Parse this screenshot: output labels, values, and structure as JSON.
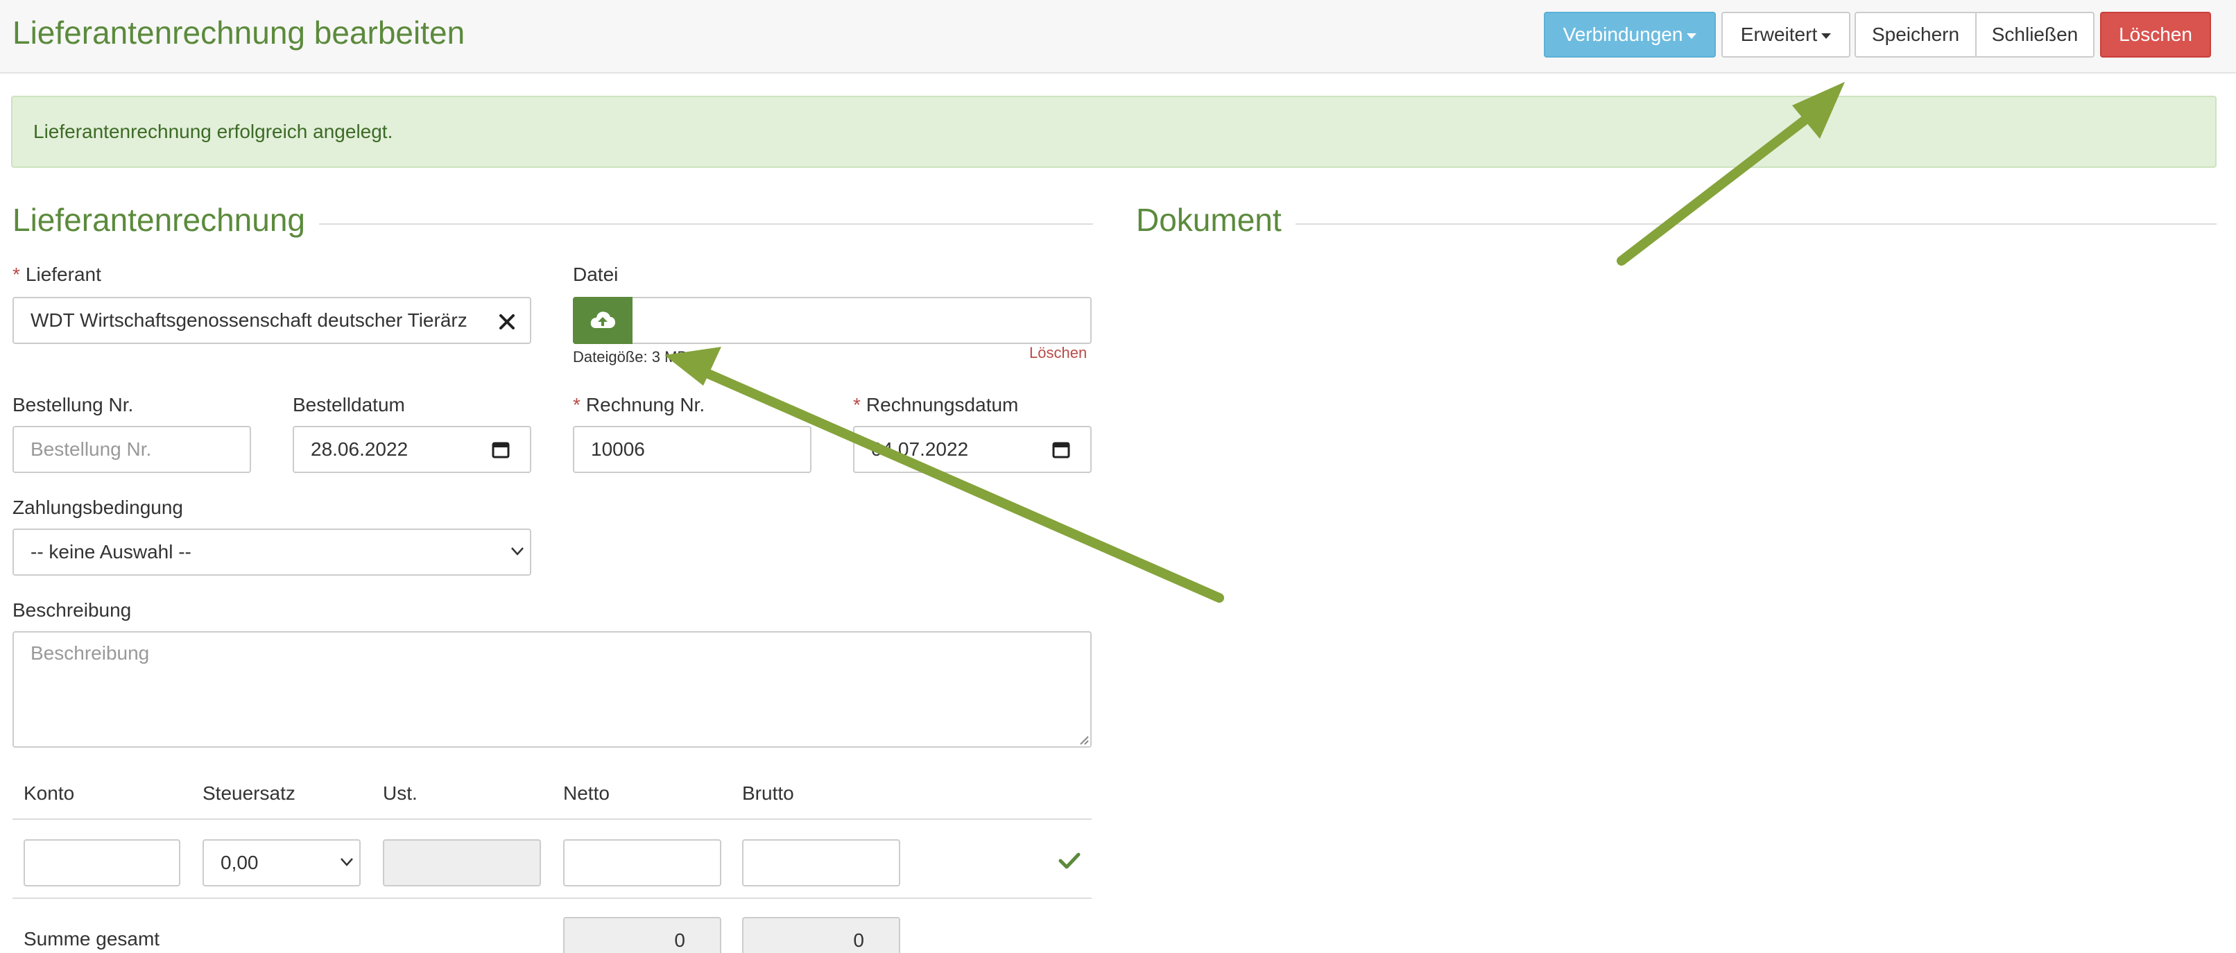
{
  "header": {
    "title": "Lieferantenrechnung bearbeiten",
    "buttons": {
      "connections": "Verbindungen",
      "advanced": "Erweitert",
      "save": "Speichern",
      "close": "Schließen",
      "delete": "Löschen"
    }
  },
  "alert": {
    "message": "Lieferantenrechnung erfolgreich angelegt."
  },
  "sections": {
    "invoice": "Lieferantenrechnung",
    "document": "Dokument"
  },
  "form": {
    "supplier": {
      "label": "Lieferant",
      "value": "WDT Wirtschaftsgenossenschaft deutscher Tierärz"
    },
    "file": {
      "label": "Datei",
      "size_text": "Dateigöße: 3 MB",
      "delete_label": "Löschen"
    },
    "order_no": {
      "label": "Bestellung Nr.",
      "placeholder": "Bestellung Nr."
    },
    "order_date": {
      "label": "Bestelldatum",
      "value": "28.06.2022"
    },
    "invoice_no": {
      "label": "Rechnung Nr.",
      "value": "10006"
    },
    "invoice_date": {
      "label": "Rechnungsdatum",
      "value": "04.07.2022"
    },
    "payment_terms": {
      "label": "Zahlungsbedingung",
      "value": "-- keine Auswahl --"
    },
    "description": {
      "label": "Beschreibung",
      "placeholder": "Beschreibung"
    }
  },
  "table": {
    "headers": [
      "Konto",
      "Steuersatz",
      "Ust.",
      "Netto",
      "Brutto"
    ],
    "row": {
      "tax_rate": "0,00"
    },
    "sum": {
      "label": "Summe gesamt",
      "net": "0",
      "gross": "0"
    }
  },
  "colors": {
    "primary_green": "#5b8a3c",
    "arrow_green": "#84a33a",
    "info_blue": "#6dbce0",
    "danger_red": "#d9534f",
    "alert_bg": "#e2efd9"
  },
  "icons": [
    "caret-down-icon",
    "close-icon",
    "cloud-upload-icon",
    "calendar-icon",
    "chevron-down-icon",
    "check-icon"
  ]
}
